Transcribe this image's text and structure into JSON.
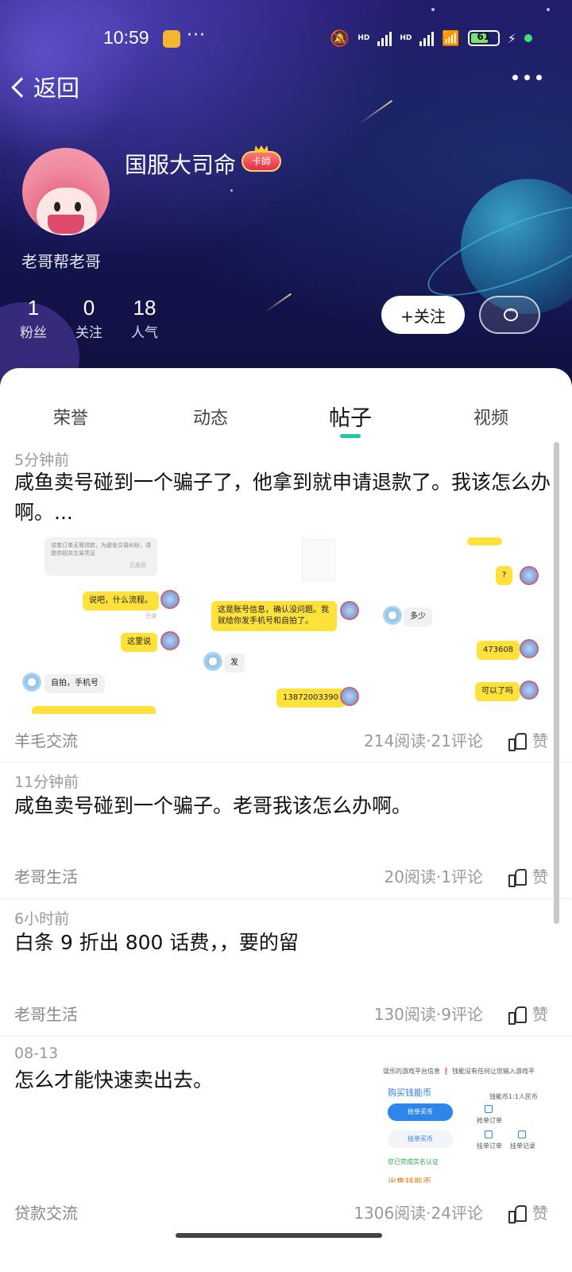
{
  "status_bar": {
    "time": "10:59",
    "extra": "···",
    "battery": "61",
    "network_1": "HD",
    "network_2": "HD"
  },
  "nav": {
    "back_label": "返回"
  },
  "profile": {
    "name": "国服大司命",
    "badge": "卡師",
    "signature": "老哥帮老哥",
    "stats": [
      {
        "value": "1",
        "label": "粉丝"
      },
      {
        "value": "0",
        "label": "关注"
      },
      {
        "value": "18",
        "label": "人气"
      }
    ],
    "follow_label": "+关注"
  },
  "tabs": [
    {
      "label": "荣誉"
    },
    {
      "label": "动态"
    },
    {
      "label": "帖子"
    },
    {
      "label": "视频"
    }
  ],
  "active_tab": "帖子",
  "posts": [
    {
      "time": "5分钟前",
      "title": "咸鱼卖号碰到一个骗子了，他拿到就申请退款了。我该怎么办啊。...",
      "category": "羊毛交流",
      "meta": "214阅读·21评论",
      "like": "赞"
    },
    {
      "time": "11分钟前",
      "title": "咸鱼卖号碰到一个骗子。老哥我该怎么办啊。",
      "category": "老哥生活",
      "meta": "20阅读·1评论",
      "like": "赞"
    },
    {
      "time": "6小时前",
      "title": "白条 9 折出 800 话费，，要的留",
      "category": "老哥生活",
      "meta": "130阅读·9评论",
      "like": "赞"
    },
    {
      "time": "08-13",
      "title": "怎么才能快速卖出去。",
      "category": "贷款交流",
      "meta": "1306阅读·24评论",
      "like": "赞"
    }
  ],
  "chat_image": {
    "top_note": "该笔订单无需退款，为避免交易纠纷，请提供相关交易凭证",
    "sent": "已发货",
    "read": "已读",
    "q": "?",
    "msg1": "说吧，什么流程。",
    "msg2": "这是账号信息，确认没问题。我就给你发手机号和自拍了。",
    "msg3": "多少",
    "msg4": "473608",
    "msg5": "这里说",
    "msg6": "发",
    "msg7": "可以了吗",
    "msg8": "自拍，手机号",
    "msg9": "13872003390"
  },
  "pay_image": {
    "notice": "误乐的游戏平台信息 ❗ 钱能没有任何让您输入游戏平",
    "buy_title": "购买钱能币",
    "rate": "钱能币1:1人民币",
    "btn_grab": "抢单买币",
    "btn_list": "挂单买币",
    "grab_orders": "抢单订单",
    "list_orders": "挂单订单",
    "list_records": "挂单记录",
    "verified": "您已完成实名认证",
    "sell_title": "出售钱能币"
  }
}
